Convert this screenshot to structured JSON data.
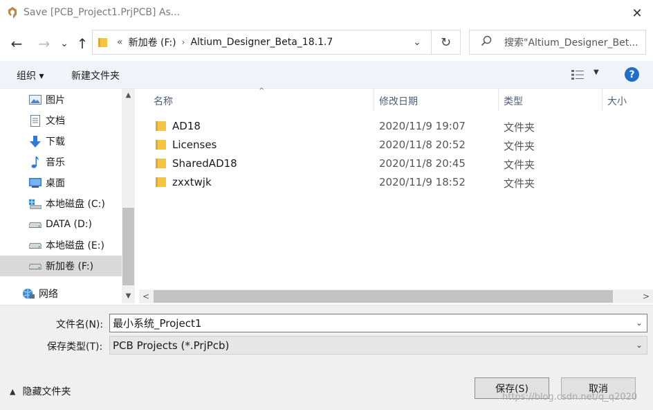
{
  "window": {
    "title": "Save [PCB_Project1.PrjPCB] As...",
    "close_glyph": "✕"
  },
  "navigation": {
    "back_glyph": "←",
    "forward_glyph": "→",
    "recent_glyph": "⌄",
    "up_glyph": "↑",
    "address": {
      "overflow": "«",
      "segments": [
        "新加卷 (F:)",
        "Altium_Designer_Beta_18.1.7"
      ],
      "separator": "›"
    },
    "dropdown_glyph": "⌄",
    "refresh_glyph": "↻",
    "search_placeholder": "搜索\"Altium_Designer_Bet...",
    "search_glyph": "⌕"
  },
  "toolbar": {
    "organize": "组织 ▾",
    "new_folder": "新建文件夹",
    "view_dropdown": "▼",
    "help": "?"
  },
  "sidebar": {
    "items": [
      {
        "label": "图片",
        "icon": "pictures-icon"
      },
      {
        "label": "文档",
        "icon": "documents-icon"
      },
      {
        "label": "下载",
        "icon": "downloads-icon"
      },
      {
        "label": "音乐",
        "icon": "music-icon"
      },
      {
        "label": "桌面",
        "icon": "desktop-icon"
      },
      {
        "label": "本地磁盘 (C:)",
        "icon": "system-drive-icon"
      },
      {
        "label": "DATA (D:)",
        "icon": "drive-icon"
      },
      {
        "label": "本地磁盘 (E:)",
        "icon": "drive-icon"
      },
      {
        "label": "新加卷 (F:)",
        "icon": "drive-icon",
        "selected": true
      },
      {
        "label": "网络",
        "icon": "network-icon"
      }
    ],
    "scroll_up": "▲",
    "scroll_down": "▼"
  },
  "file_list": {
    "columns": [
      "名称",
      "修改日期",
      "类型",
      "大小"
    ],
    "sort_caret": "^",
    "rows": [
      {
        "name": "AD18",
        "modified": "2020/11/9 19:07",
        "type": "文件夹"
      },
      {
        "name": "Licenses",
        "modified": "2020/11/8 20:52",
        "type": "文件夹"
      },
      {
        "name": "SharedAD18",
        "modified": "2020/11/8 20:45",
        "type": "文件夹"
      },
      {
        "name": "zxxtwjk",
        "modified": "2020/11/9 18:52",
        "type": "文件夹"
      }
    ],
    "scroll_left": "<",
    "scroll_right": ">"
  },
  "form": {
    "filename_label": "文件名(N):",
    "filename_value": "最小系统_Project1",
    "filetype_label": "保存类型(T):",
    "filetype_value": "PCB Projects (*.PrjPcb)",
    "chevron": "⌄"
  },
  "footer": {
    "hide_folders": "隐藏文件夹",
    "hide_caret": "▲",
    "save": "保存(S)",
    "cancel": "取消",
    "watermark": "https://blog.csdn.net/q_q2020"
  },
  "colors": {
    "accent": "#1f6fc9",
    "folder": "#f4c542",
    "selection": "#d9d9d9",
    "toolbar_bg": "#f0f4f9"
  }
}
